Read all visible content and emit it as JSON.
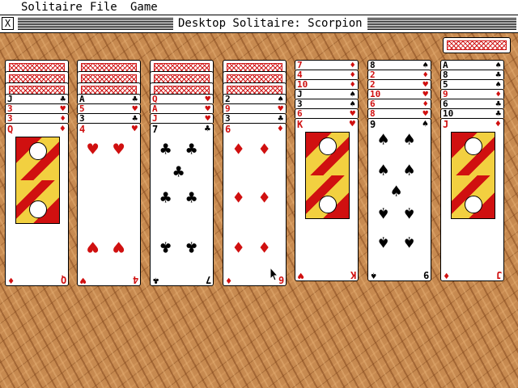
{
  "menu": {
    "items": [
      "Solitaire",
      "File",
      "Game"
    ]
  },
  "window": {
    "title": "Desktop Solitaire: Scorpion",
    "close_label": "X"
  },
  "colors": {
    "red_suit": "#d01010",
    "black_suit": "#000000",
    "table_wood": "#c78a50",
    "card_back_pattern": "#d01818"
  },
  "stock": {
    "icon": "card-back",
    "face_down": true
  },
  "columns": [
    {
      "face_down": 3,
      "face_up": [
        {
          "rank": "J",
          "suit": "♣",
          "color": "black"
        },
        {
          "rank": "3",
          "suit": "♥",
          "color": "red"
        },
        {
          "rank": "3",
          "suit": "♦",
          "color": "red"
        },
        {
          "rank": "Q",
          "suit": "♦",
          "color": "red"
        }
      ]
    },
    {
      "face_down": 3,
      "face_up": [
        {
          "rank": "A",
          "suit": "♣",
          "color": "black"
        },
        {
          "rank": "5",
          "suit": "♥",
          "color": "red"
        },
        {
          "rank": "3",
          "suit": "♣",
          "color": "black"
        },
        {
          "rank": "4",
          "suit": "♥",
          "color": "red"
        }
      ]
    },
    {
      "face_down": 3,
      "face_up": [
        {
          "rank": "Q",
          "suit": "♥",
          "color": "red"
        },
        {
          "rank": "A",
          "suit": "♥",
          "color": "red"
        },
        {
          "rank": "J",
          "suit": "♥",
          "color": "red"
        },
        {
          "rank": "7",
          "suit": "♣",
          "color": "black"
        }
      ]
    },
    {
      "face_down": 3,
      "face_up": [
        {
          "rank": "2",
          "suit": "♠",
          "color": "black"
        },
        {
          "rank": "9",
          "suit": "♥",
          "color": "red"
        },
        {
          "rank": "3",
          "suit": "♣",
          "color": "black"
        },
        {
          "rank": "6",
          "suit": "♦",
          "color": "red"
        }
      ]
    },
    {
      "face_down": 0,
      "face_up": [
        {
          "rank": "7",
          "suit": "♦",
          "color": "red"
        },
        {
          "rank": "4",
          "suit": "♦",
          "color": "red"
        },
        {
          "rank": "10",
          "suit": "♦",
          "color": "red"
        },
        {
          "rank": "J",
          "suit": "♠",
          "color": "black"
        },
        {
          "rank": "3",
          "suit": "♠",
          "color": "black"
        },
        {
          "rank": "6",
          "suit": "♥",
          "color": "red"
        },
        {
          "rank": "K",
          "suit": "♥",
          "color": "red"
        }
      ]
    },
    {
      "face_down": 0,
      "face_up": [
        {
          "rank": "8",
          "suit": "♠",
          "color": "black"
        },
        {
          "rank": "2",
          "suit": "♦",
          "color": "red"
        },
        {
          "rank": "2",
          "suit": "♥",
          "color": "red"
        },
        {
          "rank": "10",
          "suit": "♥",
          "color": "red"
        },
        {
          "rank": "6",
          "suit": "♦",
          "color": "red"
        },
        {
          "rank": "8",
          "suit": "♥",
          "color": "red"
        },
        {
          "rank": "9",
          "suit": "♠",
          "color": "black"
        }
      ]
    },
    {
      "face_down": 0,
      "face_up": [
        {
          "rank": "A",
          "suit": "♠",
          "color": "black"
        },
        {
          "rank": "8",
          "suit": "♣",
          "color": "black"
        },
        {
          "rank": "5",
          "suit": "♠",
          "color": "black"
        },
        {
          "rank": "9",
          "suit": "♦",
          "color": "red"
        },
        {
          "rank": "6",
          "suit": "♣",
          "color": "black"
        },
        {
          "rank": "10",
          "suit": "♣",
          "color": "black"
        },
        {
          "rank": "J",
          "suit": "♦",
          "color": "red"
        }
      ]
    }
  ]
}
